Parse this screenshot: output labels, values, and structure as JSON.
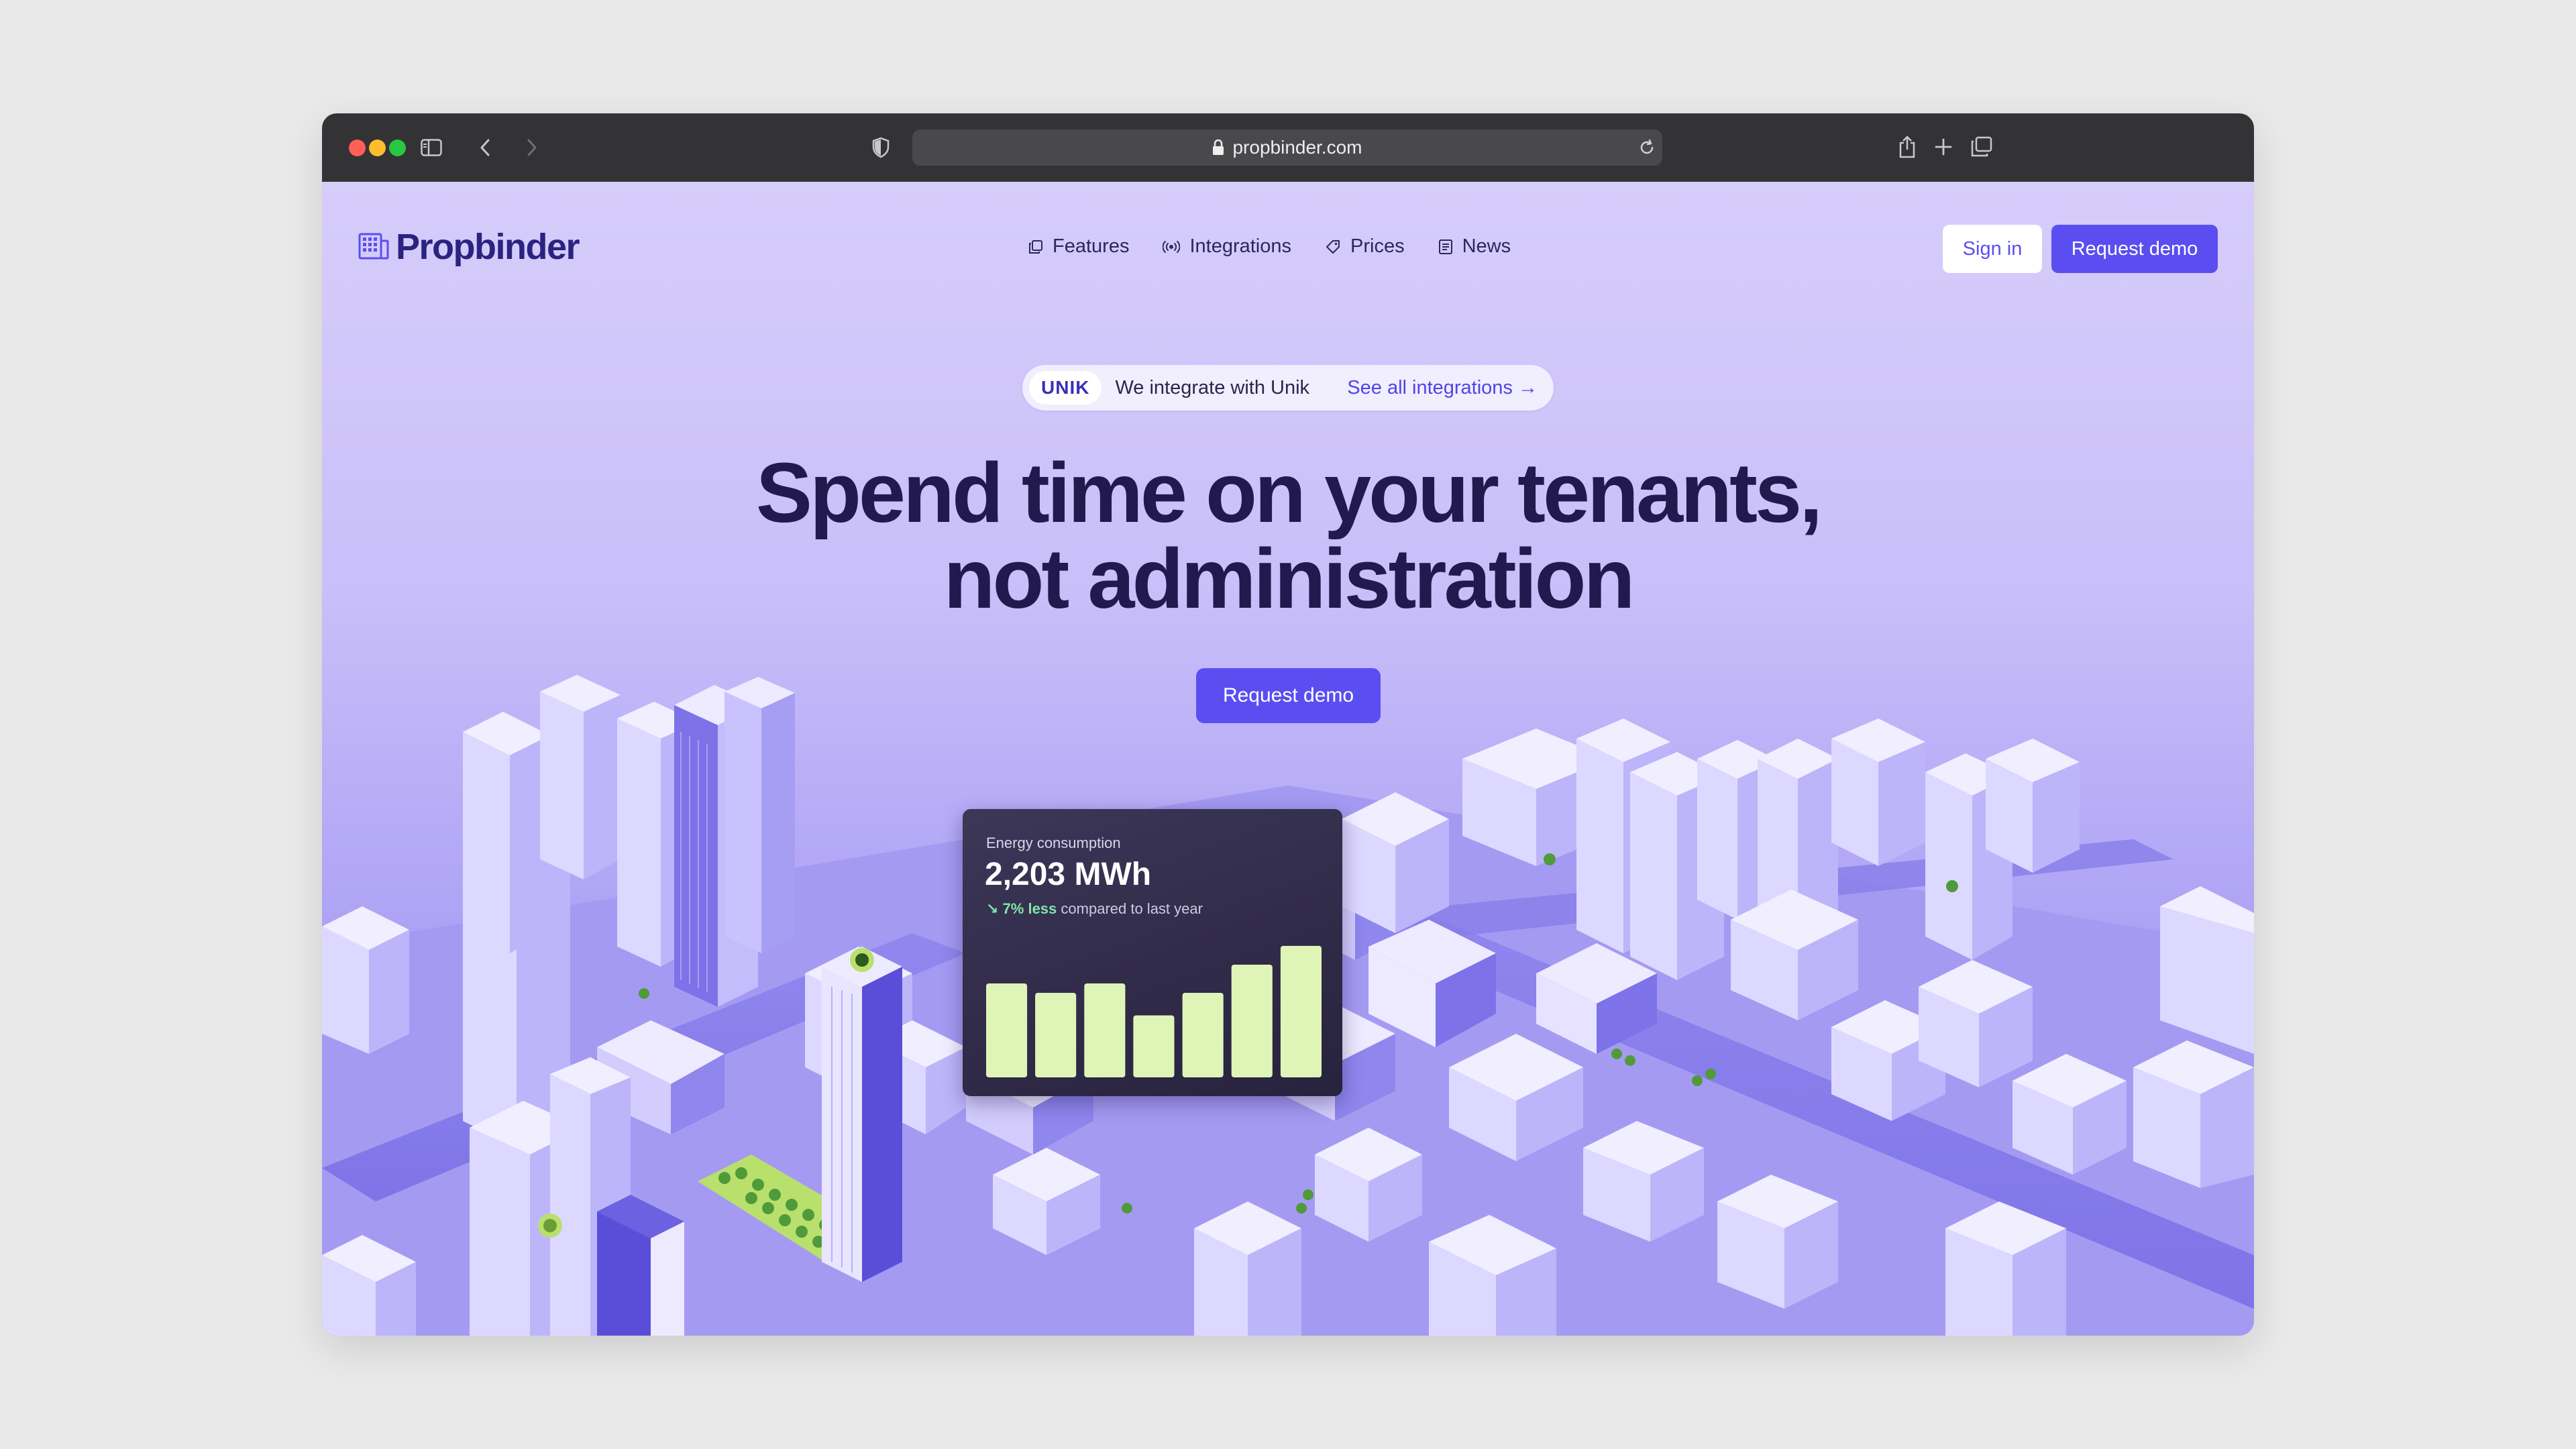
{
  "browser": {
    "url": "propbinder.com",
    "traffic_colors": [
      "#ff5f57",
      "#febc2e",
      "#28c840"
    ]
  },
  "header": {
    "logo_text": "Propbinder",
    "nav": [
      {
        "label": "Features",
        "icon": "copy-icon"
      },
      {
        "label": "Integrations",
        "icon": "broadcast-icon"
      },
      {
        "label": "Prices",
        "icon": "tag-icon"
      },
      {
        "label": "News",
        "icon": "newspaper-icon"
      }
    ],
    "sign_in": "Sign in",
    "request_demo": "Request demo"
  },
  "announcement": {
    "badge": "UNIK",
    "text": "We integrate with Unik",
    "link": "See all integrations →"
  },
  "hero": {
    "title_line1": "Spend time on your tenants,",
    "title_line2": "not administration",
    "cta": "Request demo"
  },
  "energy_card": {
    "label": "Energy consumption",
    "value": "2,203 MWh",
    "delta": "↘ 7% less",
    "compare": "compared to last year"
  },
  "chart_data": {
    "type": "bar",
    "categories": [
      "",
      "",
      "",
      "",
      "",
      "",
      ""
    ],
    "values": [
      50,
      45,
      50,
      33,
      45,
      60,
      70
    ],
    "ylim": [
      0,
      75
    ],
    "bar_color": "#dff5b8",
    "grid": false
  },
  "colors": {
    "accent": "#5a4ef0",
    "headline": "#221a4e",
    "positive": "#7fe7a5"
  }
}
